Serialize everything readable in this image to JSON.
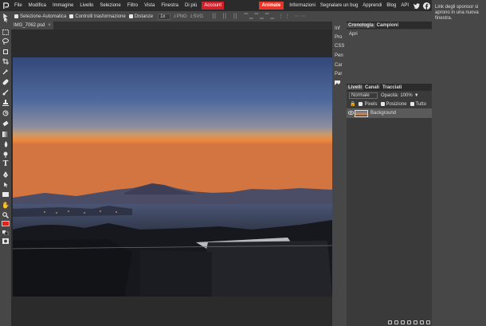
{
  "menubar": {
    "items": [
      "File",
      "Modifica",
      "Immagine",
      "Livello",
      "Selezione",
      "Filtro",
      "Vista",
      "Finestra",
      "Di più"
    ],
    "account": "Account",
    "animate": "Animate",
    "right_items": [
      "Informazioni",
      "Segnalare un bug",
      "Apprendi",
      "Blog",
      "API"
    ]
  },
  "options": {
    "auto_select": "Selezione-Automatica",
    "transform_controls": "Controlli trasformazione",
    "distances": "Distanze",
    "zoom": "1x",
    "png": "PNG",
    "svg": "SVG"
  },
  "tab": {
    "name": "IMG_7062.psd",
    "close": "×"
  },
  "narrow_panel": [
    "Inf",
    "Pro",
    "CSS",
    "Pen",
    "Car",
    "Par"
  ],
  "history_panel": {
    "tabs": [
      "Cronologia",
      "Campioni"
    ],
    "items": [
      "Apri"
    ]
  },
  "layers_panel": {
    "tabs": [
      "Livelli",
      "Canali",
      "Tracciati"
    ],
    "blend_mode": "Normale",
    "opacity_label": "Opacità:",
    "opacity_value": "100%",
    "lock_pixels": "Pixels",
    "lock_position": "Posizione",
    "lock_all": "Tutto",
    "layers": [
      {
        "name": "Background"
      }
    ]
  },
  "sponsor": {
    "text": "Link degli sponsor si aprono in una nuova finestra."
  },
  "colors": {
    "accent_red": "#d0202a",
    "panel_bg": "#474747",
    "dark_bg": "#2b2b2b",
    "foreground_color": "#e2221e",
    "background_color": "#ffffff"
  }
}
